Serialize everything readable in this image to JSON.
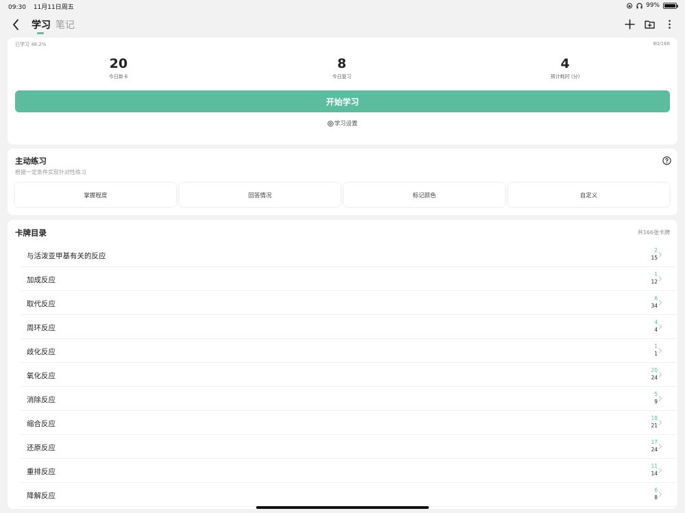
{
  "status_bar": {
    "time": "09:30",
    "date": "11月11日周五",
    "battery": "99%"
  },
  "nav": {
    "tab_study": "学习",
    "tab_notes": "笔记"
  },
  "study": {
    "progress_label": "已学习 48.2%",
    "progress_count": "80/166",
    "stats": [
      {
        "value": "20",
        "label": "今日新卡"
      },
      {
        "value": "8",
        "label": "今日复习"
      },
      {
        "value": "4",
        "label": "预计耗时 (分)"
      }
    ],
    "start_button": "开始学习",
    "settings_link": "学习设置"
  },
  "practice": {
    "title": "主动练习",
    "subtitle": "根据一定条件实现针对性练习",
    "buttons": [
      "掌握程度",
      "回答情况",
      "标记颜色",
      "自定义"
    ]
  },
  "catalog": {
    "title": "卡牌目录",
    "count": "共166张卡牌",
    "items": [
      {
        "name": "与活泼亚甲基有关的反应",
        "a": "2",
        "b": "15"
      },
      {
        "name": "加成反应",
        "a": "1",
        "b": "12"
      },
      {
        "name": "取代反应",
        "a": "6",
        "b": "34"
      },
      {
        "name": "周环反应",
        "a": "4",
        "b": "4"
      },
      {
        "name": "歧化反应",
        "a": "1",
        "b": "1"
      },
      {
        "name": "氧化反应",
        "a": "20",
        "b": "24"
      },
      {
        "name": "消除反应",
        "a": "5",
        "b": "9"
      },
      {
        "name": "缩合反应",
        "a": "18",
        "b": "21"
      },
      {
        "name": "还原反应",
        "a": "17",
        "b": "24"
      },
      {
        "name": "重排反应",
        "a": "11",
        "b": "14"
      },
      {
        "name": "降解反应",
        "a": "6",
        "b": "8"
      }
    ]
  },
  "colors": {
    "accent": "#5bbd9d"
  }
}
